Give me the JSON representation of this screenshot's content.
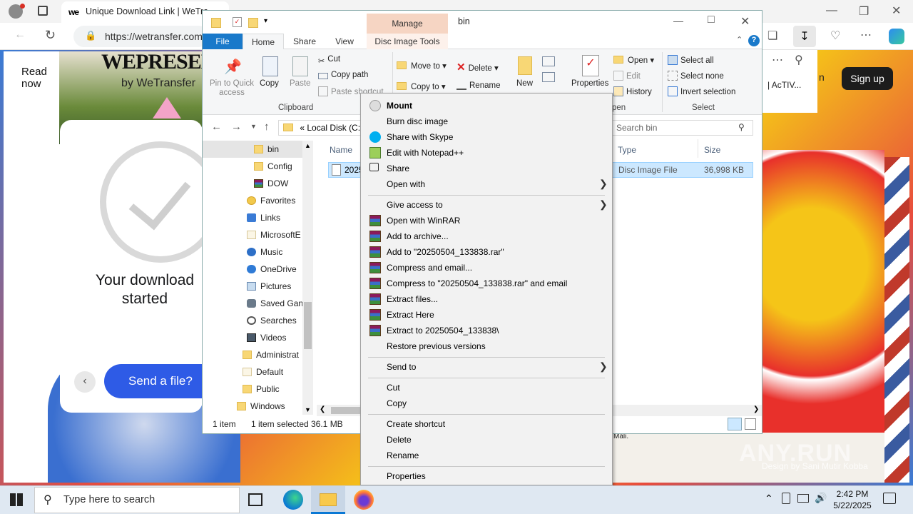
{
  "browser": {
    "tab_title": "Unique Download Link | WeTra",
    "url": "https://wetransfer.com",
    "wetransfer": {
      "read_now": "Read now",
      "brand_line1": "WEPRESEN",
      "brand_line2": "by WeTransfer",
      "download_msg": "Your download started",
      "send_button": "Send a file?",
      "signup": "Sign up",
      "activ": "| AcTIV...",
      "mali": "Mali.",
      "credit": "Design by Sani Mutir Kobba",
      "partial_n": "n"
    }
  },
  "explorer": {
    "title": "bin",
    "manage_tab": "Manage",
    "tabs": [
      "File",
      "Home",
      "Share",
      "View",
      "Disc Image Tools"
    ],
    "ribbon": {
      "pin": "Pin to Quick access",
      "copy": "Copy",
      "paste": "Paste",
      "cut": "Cut",
      "copy_path": "Copy path",
      "paste_shortcut": "Paste shortcut",
      "clipboard_group": "Clipboard",
      "move_to": "Move to",
      "copy_to": "Copy to",
      "delete": "Delete",
      "rename": "Rename",
      "new_folder": "New folder",
      "properties": "Properties",
      "open": "Open",
      "edit": "Edit",
      "history": "History",
      "open_group": "pen",
      "select_all": "Select all",
      "select_none": "Select none",
      "invert_selection": "Invert selection",
      "select_group": "Select"
    },
    "breadcrumb": "Local Disk (C:)",
    "breadcrumb_prefix": "«",
    "search_placeholder": "Search bin",
    "nav_items": [
      {
        "label": "bin",
        "type": "folder",
        "selected": true
      },
      {
        "label": "Config",
        "type": "folder"
      },
      {
        "label": "DOW",
        "type": "rar"
      },
      {
        "label": "Favorites",
        "type": "star"
      },
      {
        "label": "Links",
        "type": "link"
      },
      {
        "label": "MicrosoftE",
        "type": "folder-white"
      },
      {
        "label": "Music",
        "type": "music"
      },
      {
        "label": "OneDrive",
        "type": "cloud"
      },
      {
        "label": "Pictures",
        "type": "pictures"
      },
      {
        "label": "Saved Gan",
        "type": "games"
      },
      {
        "label": "Searches",
        "type": "search"
      },
      {
        "label": "Videos",
        "type": "video"
      },
      {
        "label": "Administrat",
        "type": "folder"
      },
      {
        "label": "Default",
        "type": "folder-white"
      },
      {
        "label": "Public",
        "type": "folder"
      },
      {
        "label": "Windows",
        "type": "folder"
      }
    ],
    "columns": {
      "name": "Name",
      "type": "Type",
      "size": "Size"
    },
    "file": {
      "name": "2025",
      "type": "Disc Image File",
      "size": "36,998 KB"
    },
    "status": {
      "count": "1 item",
      "selected": "1 item selected",
      "size": "36.1 MB"
    }
  },
  "context_menu": {
    "items": [
      {
        "label": "Mount",
        "bold": true,
        "icon": "disc-icon"
      },
      {
        "label": "Burn disc image"
      },
      {
        "label": "Share with Skype",
        "icon": "skype-icon"
      },
      {
        "label": "Edit with Notepad++",
        "icon": "notepad-icon"
      },
      {
        "label": "Share",
        "icon": "share-icon"
      },
      {
        "label": "Open with",
        "arrow": true
      },
      {
        "sep": true
      },
      {
        "label": "Give access to",
        "arrow": true
      },
      {
        "label": "Open with WinRAR",
        "icon": "winrar-icon"
      },
      {
        "label": "Add to archive...",
        "icon": "winrar-icon"
      },
      {
        "label": "Add to \"20250504_133838.rar\"",
        "icon": "winrar-icon"
      },
      {
        "label": "Compress and email...",
        "icon": "winrar-icon"
      },
      {
        "label": "Compress to \"20250504_133838.rar\" and email",
        "icon": "winrar-icon"
      },
      {
        "label": "Extract files...",
        "icon": "winrar-icon"
      },
      {
        "label": "Extract Here",
        "icon": "winrar-icon"
      },
      {
        "label": "Extract to 20250504_133838\\",
        "icon": "winrar-icon"
      },
      {
        "label": "Restore previous versions"
      },
      {
        "sep": true
      },
      {
        "label": "Send to",
        "arrow": true
      },
      {
        "sep": true
      },
      {
        "label": "Cut"
      },
      {
        "label": "Copy"
      },
      {
        "sep": true
      },
      {
        "label": "Create shortcut"
      },
      {
        "label": "Delete"
      },
      {
        "label": "Rename"
      },
      {
        "sep": true
      },
      {
        "label": "Properties"
      }
    ]
  },
  "taskbar": {
    "search_placeholder": "Type here to search",
    "time": "2:42 PM",
    "date": "5/22/2025"
  },
  "watermark": "ANY.RUN"
}
